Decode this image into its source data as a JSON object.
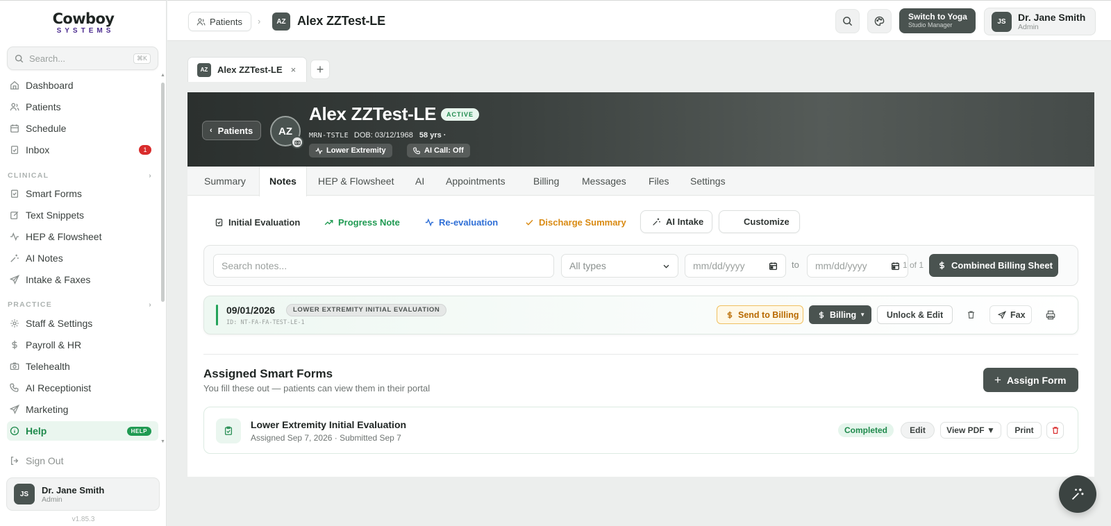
{
  "sidebar": {
    "logo_line1": "Cowboy",
    "logo_line2": "SYSTEMS",
    "search_placeholder": "Search...",
    "search_shortcut": "⌘K",
    "items": [
      {
        "label": "Dashboard",
        "icon": "home-icon"
      },
      {
        "label": "Patients",
        "icon": "patients-icon"
      },
      {
        "label": "Schedule",
        "icon": "calendar-icon"
      },
      {
        "label": "Inbox",
        "icon": "inbox-icon",
        "badge": "1"
      }
    ],
    "clinical_label": "CLINICAL",
    "clinical_items": [
      {
        "label": "Smart Forms",
        "icon": "clipboard-icon"
      },
      {
        "label": "Text Snippets",
        "icon": "edit-icon"
      },
      {
        "label": "HEP & Flowsheet",
        "icon": "activity-icon"
      },
      {
        "label": "AI Notes",
        "icon": "sparkle-icon"
      },
      {
        "label": "Intake & Faxes",
        "icon": "send-icon"
      }
    ],
    "practice_label": "PRACTICE",
    "practice_items": [
      {
        "label": "Staff & Settings",
        "icon": "gear-icon"
      },
      {
        "label": "Payroll & HR",
        "icon": "dollar-icon"
      },
      {
        "label": "Telehealth",
        "icon": "camera-icon"
      },
      {
        "label": "AI Receptionist",
        "icon": "phone-icon"
      },
      {
        "label": "Marketing",
        "icon": "send-icon"
      },
      {
        "label": "Help",
        "icon": "info-icon",
        "badge": "HELP",
        "active": true
      }
    ],
    "sign_out": "Sign Out",
    "user_initials": "JS",
    "user_name": "Dr. Jane Smith",
    "user_role": "Admin",
    "version": "v1.85.3"
  },
  "topbar": {
    "crumb_patients": "Patients",
    "crumb_initials": "AZ",
    "crumb_title": "Alex ZZTest-LE",
    "switch_title": "Switch to Yoga",
    "switch_sub": "Studio Manager",
    "user_initials": "JS",
    "user_name": "Dr. Jane Smith",
    "user_role": "Admin"
  },
  "patient_tab": {
    "initials": "AZ",
    "label": "Alex ZZTest-LE",
    "close": "×",
    "add": "+"
  },
  "patient": {
    "back_label": "Patients",
    "initials": "AZ",
    "name": "Alex ZZTest-LE",
    "status": "ACTIVE",
    "mrn": "MRN-TSTLE",
    "dob": "DOB: 03/12/1968",
    "age": "58 yrs ·",
    "tag_region": "Lower Extremity",
    "tag_ai_call": "AI Call: Off"
  },
  "tabs": [
    "Summary",
    "Notes",
    "HEP & Flowsheet",
    "AI",
    "Appointments",
    "Billing",
    "Messages",
    "Files",
    "Settings"
  ],
  "note_types": {
    "initial": "Initial Evaluation",
    "progress": "Progress Note",
    "reeval": "Re-evaluation",
    "discharge": "Discharge Summary",
    "ai_intake": "AI Intake",
    "customize": "Customize"
  },
  "colors": {
    "progress": "#1f9a52",
    "reeval": "#2f6fd6",
    "discharge": "#d98a12",
    "accent_dark": "#4a5350"
  },
  "filters": {
    "search_placeholder": "Search notes...",
    "type_value": "All types",
    "date_placeholder": "mm/dd/yyyy",
    "to": "to",
    "pager": "1 of 1",
    "combined_billing": "Combined Billing Sheet"
  },
  "note": {
    "date": "09/01/2026",
    "type": "LOWER EXTREMITY INITIAL EVALUATION",
    "id": "ID: NT-FA-FA-TEST-LE-1",
    "send_billing": "Send to Billing",
    "billing": "Billing",
    "unlock": "Unlock & Edit",
    "fax": "Fax"
  },
  "smart_forms": {
    "title": "Assigned Smart Forms",
    "subtitle": "You fill these out — patients can view them in their portal",
    "assign": "Assign Form",
    "form_title": "Lower Extremity Initial Evaluation",
    "form_sub": "Assigned Sep 7, 2026 · Submitted Sep 7",
    "status": "Completed",
    "edit": "Edit",
    "view_pdf": "View PDF ▼",
    "print": "Print"
  }
}
